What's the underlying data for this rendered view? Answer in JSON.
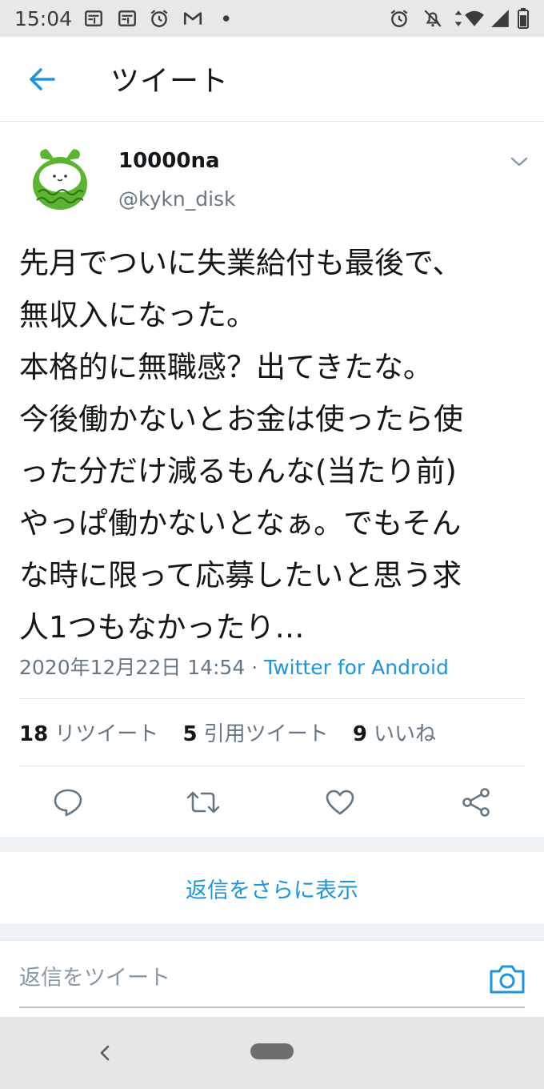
{
  "status_bar": {
    "time": "15:04",
    "left_icons": [
      "document-icon",
      "document-icon",
      "alarm-icon",
      "gmail-icon",
      "dot-icon"
    ],
    "right_icons": [
      "alarm-icon",
      "mute-icon",
      "data-arrows-icon",
      "wifi-icon",
      "signal-icon",
      "battery-icon"
    ]
  },
  "header": {
    "title": "ツイート",
    "back_icon": "arrow-left-icon"
  },
  "tweet": {
    "display_name": "10000na",
    "handle": "@kykn_disk",
    "lines": [
      "先月でついに失業給付も最後で、",
      "無収入になった。",
      "本格的に無職感？出てきたな。",
      "今後働かないとお金は使ったら使",
      "った分だけ減るもんな(当たり前)",
      "やっぱ働かないとなぁ。でもそん",
      "な時に限って応募したいと思う求",
      "人1つもなかったり…"
    ],
    "timestamp": "2020年12月22日 14:54",
    "separator": " · ",
    "source": "Twitter for Android"
  },
  "stats": [
    {
      "count": "18",
      "label": "リツイート"
    },
    {
      "count": "5",
      "label": "引用ツイート"
    },
    {
      "count": "9",
      "label": "いいね"
    }
  ],
  "actions": [
    "reply-icon",
    "retweet-icon",
    "like-icon",
    "share-icon"
  ],
  "more_replies_label": "返信をさらに表示",
  "reply": {
    "placeholder": "返信をツイート"
  },
  "colors": {
    "accent": "#1b95e0",
    "text_primary": "#14171a",
    "text_secondary": "#657786",
    "avatar_green": "#5bb531"
  }
}
